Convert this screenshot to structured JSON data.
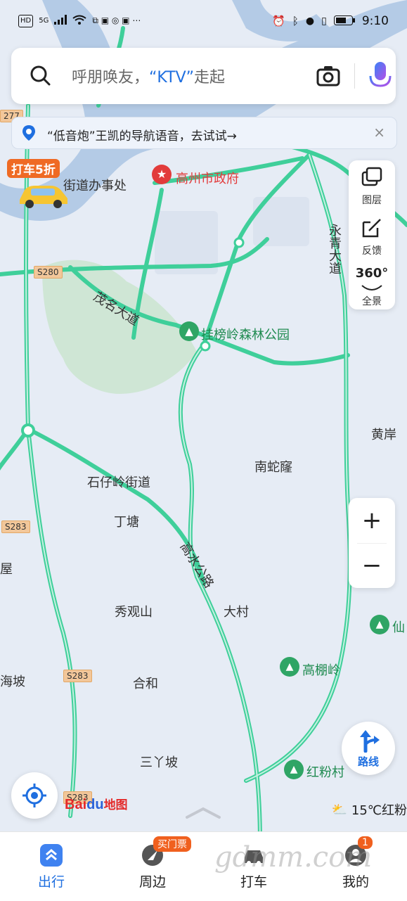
{
  "status_bar": {
    "left_icons": [
      "HD",
      "5G",
      "signal-icon",
      "wifi-icon"
    ],
    "right_time": "9:10"
  },
  "search": {
    "placeholder_prefix": "呼朋唤友，",
    "placeholder_keyword": "“KTV”",
    "placeholder_suffix": "走起"
  },
  "banner": {
    "text": "“低音炮”王凯的导航语音，去试试→",
    "close": "×"
  },
  "promo": {
    "tag": "打车5折"
  },
  "side_panel": {
    "items": [
      {
        "label": "图层",
        "icon": "layers-icon"
      },
      {
        "label": "反馈",
        "icon": "feedback-icon"
      },
      {
        "label": "全景",
        "icon": "panorama-360-icon",
        "icon_text": "360°"
      }
    ]
  },
  "zoom": {
    "in": "+",
    "out": "−"
  },
  "route_button": {
    "label": "路线"
  },
  "logo": {
    "part1": "Bai",
    "part2": "du",
    "part3": "地图"
  },
  "weather": {
    "text": "15℃红粉"
  },
  "map_labels": [
    {
      "text": "街道办事处",
      "kind": "area"
    },
    {
      "text": "高州市政府",
      "kind": "poi-red"
    },
    {
      "text": "茂名大道",
      "kind": "road"
    },
    {
      "text": "挂榜岭森林公园",
      "kind": "poi-green"
    },
    {
      "text": "永青大道",
      "kind": "road"
    },
    {
      "text": "黄岸",
      "kind": "place"
    },
    {
      "text": "南蛇窿",
      "kind": "place"
    },
    {
      "text": "石仔岭街道",
      "kind": "area"
    },
    {
      "text": "丁塘",
      "kind": "place"
    },
    {
      "text": "高水公路",
      "kind": "road"
    },
    {
      "text": "秀观山",
      "kind": "place"
    },
    {
      "text": "大村",
      "kind": "place"
    },
    {
      "text": "高棚岭",
      "kind": "poi-green"
    },
    {
      "text": "合和",
      "kind": "place"
    },
    {
      "text": "三丫坡",
      "kind": "place"
    },
    {
      "text": "红粉村",
      "kind": "poi-green"
    },
    {
      "text": "屋",
      "kind": "place"
    },
    {
      "text": "海坡",
      "kind": "place"
    },
    {
      "text": "仙",
      "kind": "poi-green"
    }
  ],
  "road_shields": [
    "S280",
    "S283",
    "S283",
    "S283",
    "277"
  ],
  "tabs": [
    {
      "label": "出行",
      "active": true,
      "icon": "travel-icon"
    },
    {
      "label": "周边",
      "active": false,
      "icon": "nearby-icon",
      "badge": "买门票"
    },
    {
      "label": "打车",
      "active": false,
      "icon": "taxi-icon"
    },
    {
      "label": "我的",
      "active": false,
      "icon": "profile-icon",
      "badge": "1"
    }
  ],
  "watermark": "gdmm.com",
  "colors": {
    "accent": "#1f6fe0",
    "road": "#3fcf9a",
    "poi_red": "#e23b3b",
    "poi_green": "#1e8a4f",
    "map_bg": "#e6ecf5",
    "park": "#cfe6d5",
    "water": "#b4cbe6"
  }
}
